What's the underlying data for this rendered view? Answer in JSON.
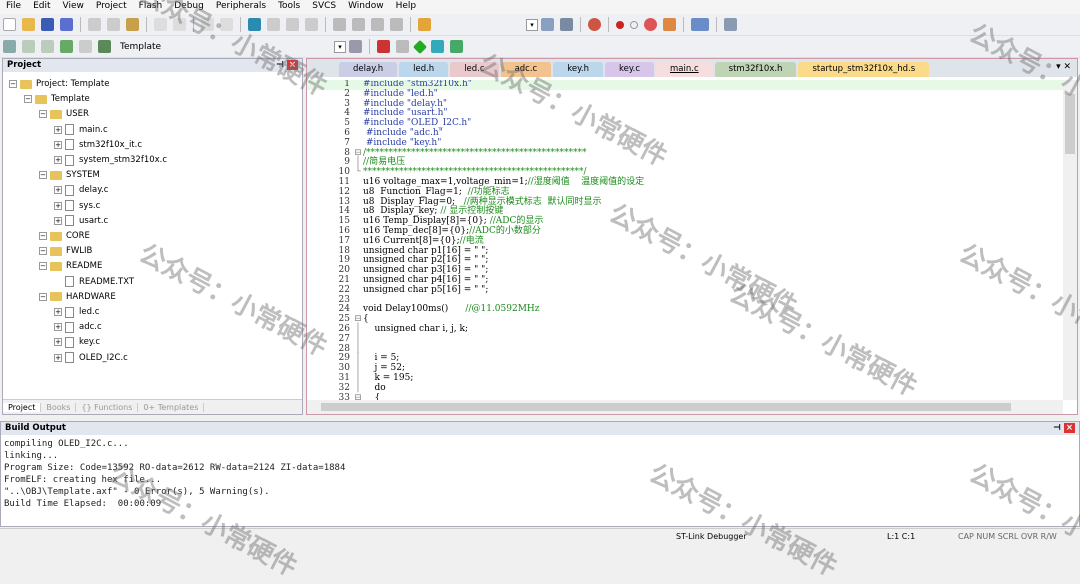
{
  "menu": [
    "File",
    "Edit",
    "View",
    "Project",
    "Flash",
    "Debug",
    "Peripherals",
    "Tools",
    "SVCS",
    "Window",
    "Help"
  ],
  "toolbar": {
    "target": "Template"
  },
  "project_panel": {
    "title": "Project",
    "tree": [
      {
        "label": "Project: Template",
        "level": 0,
        "type": "root"
      },
      {
        "label": "Template",
        "level": 1,
        "type": "folder"
      },
      {
        "label": "USER",
        "level": 2,
        "type": "folder"
      },
      {
        "label": "main.c",
        "level": 3,
        "type": "file"
      },
      {
        "label": "stm32f10x_it.c",
        "level": 3,
        "type": "file"
      },
      {
        "label": "system_stm32f10x.c",
        "level": 3,
        "type": "file"
      },
      {
        "label": "SYSTEM",
        "level": 2,
        "type": "folder"
      },
      {
        "label": "delay.c",
        "level": 3,
        "type": "file"
      },
      {
        "label": "sys.c",
        "level": 3,
        "type": "file"
      },
      {
        "label": "usart.c",
        "level": 3,
        "type": "file"
      },
      {
        "label": "CORE",
        "level": 2,
        "type": "folder"
      },
      {
        "label": "FWLIB",
        "level": 2,
        "type": "folder"
      },
      {
        "label": "README",
        "level": 2,
        "type": "folder"
      },
      {
        "label": "README.TXT",
        "level": 3,
        "type": "file-noexp"
      },
      {
        "label": "HARDWARE",
        "level": 2,
        "type": "folder"
      },
      {
        "label": "led.c",
        "level": 3,
        "type": "file"
      },
      {
        "label": "adc.c",
        "level": 3,
        "type": "file"
      },
      {
        "label": "key.c",
        "level": 3,
        "type": "file"
      },
      {
        "label": "OLED_I2C.c",
        "level": 3,
        "type": "file"
      }
    ],
    "tabs": [
      "Project",
      "Books",
      "{} Functions",
      "0+ Templates"
    ]
  },
  "editor": {
    "tabs": [
      {
        "label": "delay.h",
        "color": "#c9cde6"
      },
      {
        "label": "led.h",
        "color": "#bcd6ec"
      },
      {
        "label": "led.c",
        "color": "#e9c9cc"
      },
      {
        "label": "adc.c",
        "color": "#f3c38f"
      },
      {
        "label": "key.h",
        "color": "#bcd6ec"
      },
      {
        "label": "key.c",
        "color": "#d8c6ea"
      },
      {
        "label": "main.c",
        "color": "#f7dede",
        "active": true
      },
      {
        "label": "stm32f10x.h",
        "color": "#bfd4b5"
      },
      {
        "label": "startup_stm32f10x_hd.s",
        "color": "#fbdb8a"
      }
    ],
    "lines": [
      {
        "c": "#include \"stm32f10x.h\"",
        "k": "pp"
      },
      {
        "c": "#include \"led.h\"",
        "k": "pp"
      },
      {
        "c": "#include \"delay.h\"",
        "k": "pp"
      },
      {
        "c": "#include \"usart.h\"",
        "k": "pp"
      },
      {
        "c": "#include \"OLED_I2C.h\"",
        "k": "pp"
      },
      {
        "c": " #include \"adc.h\"",
        "k": "pp"
      },
      {
        "c": " #include \"key.h\"",
        "k": "pp"
      },
      {
        "c": "/*************************************************",
        "k": "cm",
        "f": "⊟"
      },
      {
        "c": "//简易电压",
        "k": "cm",
        "f": "│"
      },
      {
        "c": "*************************************************/",
        "k": "cm",
        "f": "└"
      },
      {
        "c": "u16 voltage_max=1,voltage_min=1;",
        "m": "//湿度阈值    温度阈值的设定"
      },
      {
        "c": "u8  Function_Flag=1;  ",
        "m": "//功能标志"
      },
      {
        "c": "u8  Display_Flag=0;   ",
        "m": "//两种显示模式标志  默认同时显示"
      },
      {
        "c": "u8  Display_key; ",
        "m": "// 显示控制按键"
      },
      {
        "c": "u16 Temp_Display[8]={0}; ",
        "m": "//ADC的显示"
      },
      {
        "c": "u16 Temp_dec[8]={0};",
        "m": "//ADC的小数部分"
      },
      {
        "c": "u16 Current[8]={0};",
        "m": "//电流"
      },
      {
        "c": "unsigned char p1[16] = \" \";"
      },
      {
        "c": "unsigned char p2[16] = \" \";"
      },
      {
        "c": "unsigned char p3[16] = \" \";"
      },
      {
        "c": "unsigned char p4[16] = \" \";"
      },
      {
        "c": "unsigned char p5[16] = \" \";"
      },
      {
        "c": ""
      },
      {
        "c": "void Delay100ms()      ",
        "m": "//@11.0592MHz"
      },
      {
        "c": "{",
        "f": "⊟"
      },
      {
        "c": "    unsigned char i, j, k;",
        "f": "│"
      },
      {
        "c": "",
        "f": "│"
      },
      {
        "c": "",
        "f": "│"
      },
      {
        "c": "    i = 5;",
        "f": "│"
      },
      {
        "c": "    j = 52;",
        "f": "│"
      },
      {
        "c": "    k = 195;",
        "f": "│"
      },
      {
        "c": "    do",
        "f": "│"
      },
      {
        "c": "    {",
        "f": "⊟"
      }
    ]
  },
  "build_output": {
    "title": "Build Output",
    "lines": [
      "compiling OLED_I2C.c...",
      "linking...",
      "Program Size: Code=13592 RO-data=2612 RW-data=2124 ZI-data=1884",
      "FromELF: creating hex file...",
      "\"..\\OBJ\\Template.axf\" - 0 Error(s), 5 Warning(s).",
      "Build Time Elapsed:  00:00:09"
    ]
  },
  "status": {
    "debugger": "ST-Link Debugger",
    "position": "L:1 C:1",
    "flags": "CAP NUM SCRL OVR R/W"
  },
  "watermark": "公众号：小常硬件"
}
